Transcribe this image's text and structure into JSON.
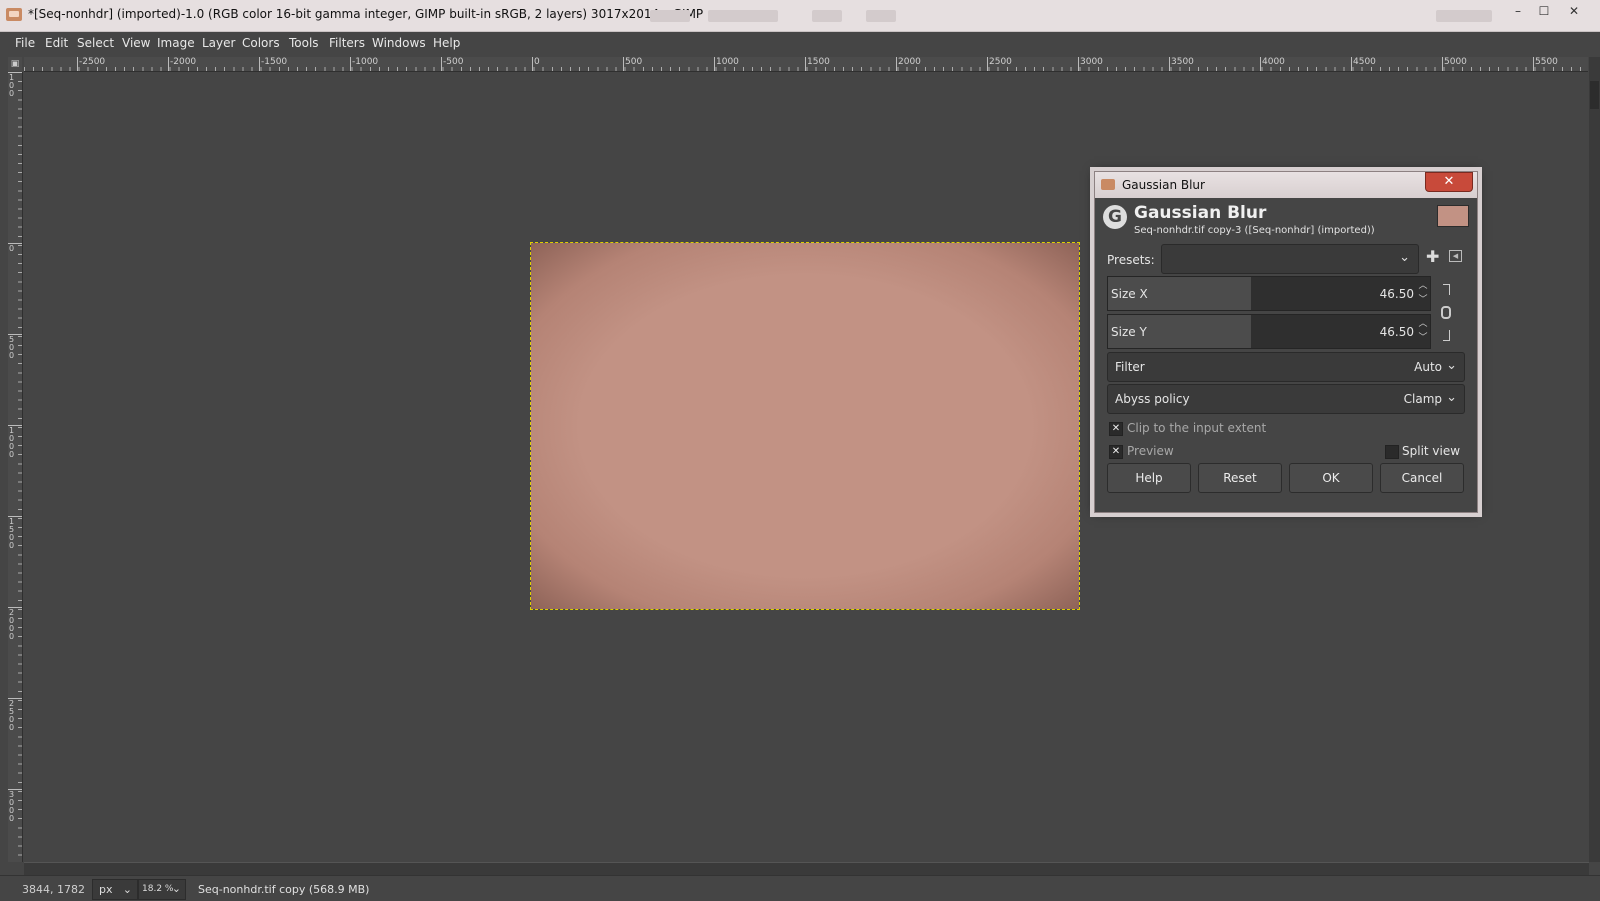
{
  "window": {
    "title": "*[Seq-nonhdr] (imported)-1.0 (RGB color 16-bit gamma integer, GIMP built-in sRGB, 2 layers) 3017x2014 – GIMP",
    "controls": {
      "minimize": "–",
      "maximize": "☐",
      "close": "✕"
    }
  },
  "menubar": [
    "File",
    "Edit",
    "Select",
    "View",
    "Image",
    "Layer",
    "Colors",
    "Tools",
    "Filters",
    "Windows",
    "Help"
  ],
  "ruler": {
    "horizontal": [
      "-2500",
      "-2000",
      "-1500",
      "-1000",
      "-500",
      "0",
      "500",
      "1000",
      "1500",
      "2000",
      "2500",
      "3000",
      "3500",
      "4000",
      "4500",
      "5000",
      "5500"
    ],
    "vertical": [
      "100",
      "0",
      "500",
      "1000",
      "1500",
      "2000",
      "2500",
      "3000"
    ]
  },
  "canvas": {
    "image_color": "#c29284",
    "selection_color": "#e0d000"
  },
  "statusbar": {
    "coords": "3844, 1782",
    "unit": "px",
    "zoom": "18.2 %",
    "message": "Seq-nonhdr.tif copy (568.9 MB)"
  },
  "dialog": {
    "window_title": "Gaussian Blur",
    "close_label": "✕",
    "heading": "Gaussian Blur",
    "subtitle": "Seq-nonhdr.tif copy-3 ([Seq-nonhdr] (imported))",
    "presets_label": "Presets:",
    "presets_value": "",
    "size_x_label": "Size X",
    "size_x_value": "46.50",
    "size_y_label": "Size Y",
    "size_y_value": "46.50",
    "filter_label": "Filter",
    "filter_value": "Auto",
    "abyss_label": "Abyss policy",
    "abyss_value": "Clamp",
    "clip_label": "Clip to the input extent",
    "clip_checked": true,
    "preview_label": "Preview",
    "preview_checked": true,
    "split_label": "Split view",
    "split_checked": false,
    "buttons": {
      "help": "Help",
      "reset": "Reset",
      "ok": "OK",
      "cancel": "Cancel"
    }
  }
}
